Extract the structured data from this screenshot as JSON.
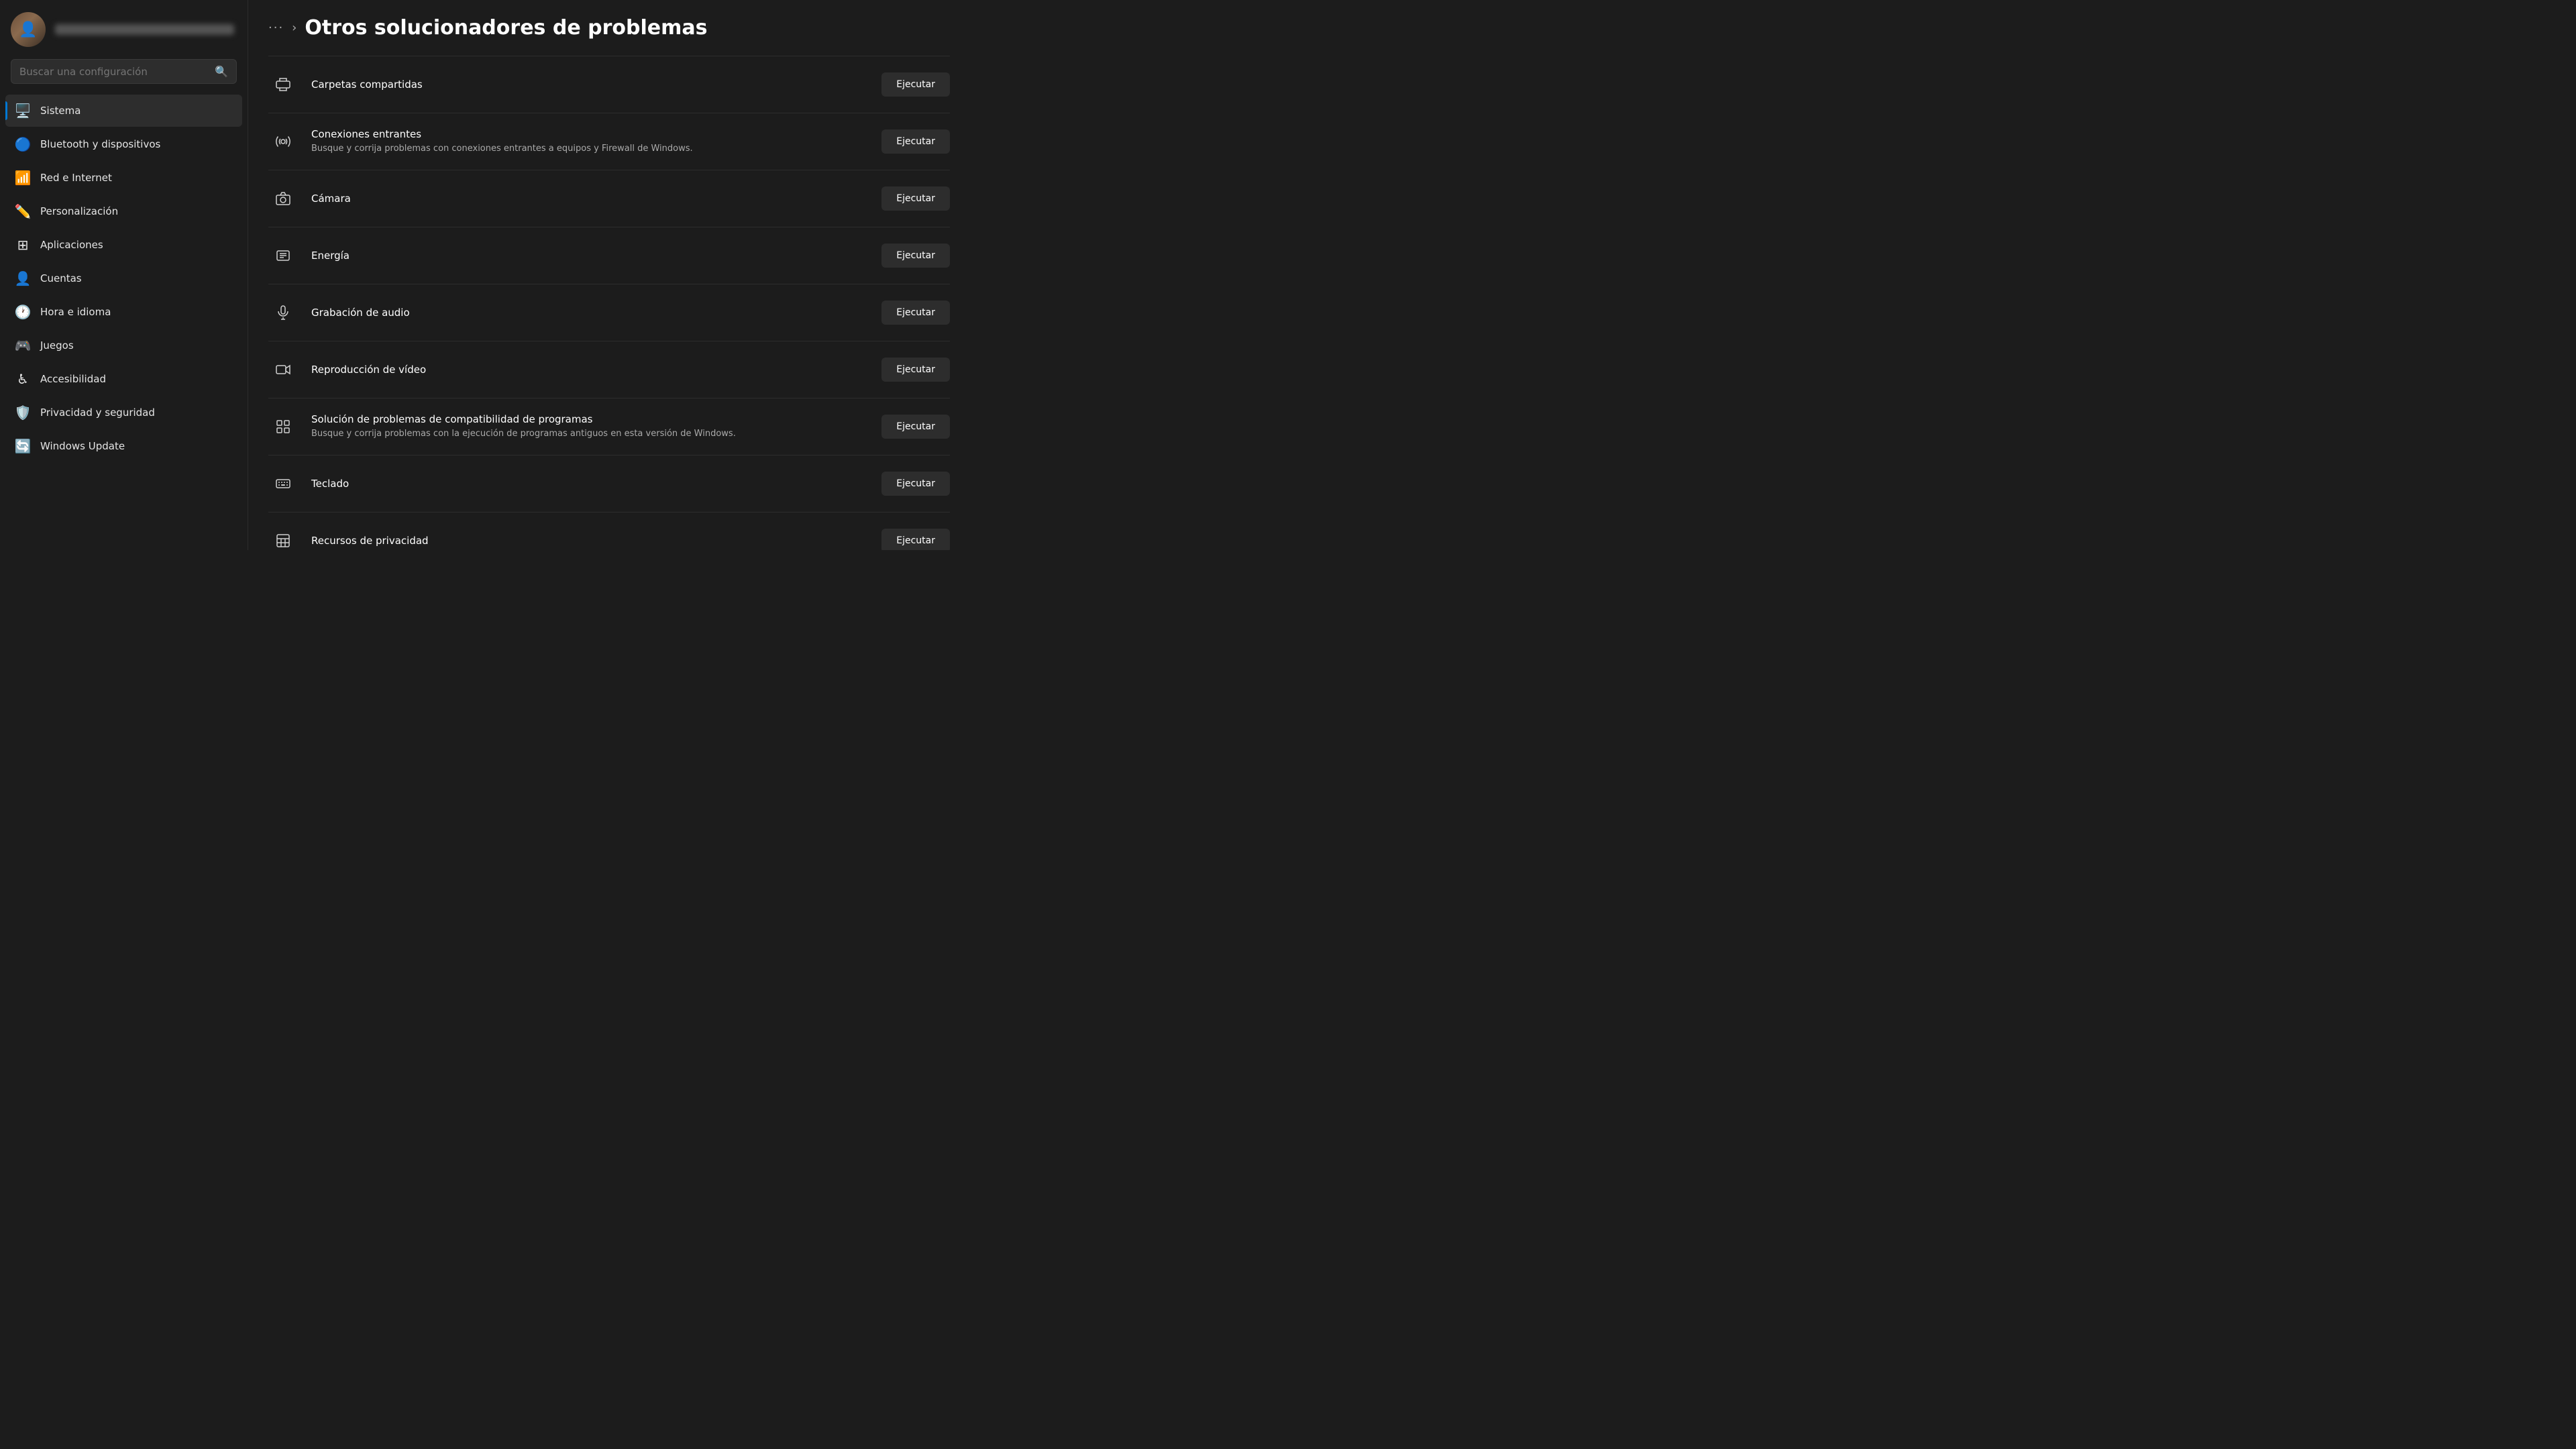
{
  "sidebar": {
    "search_placeholder": "Buscar una configuración",
    "items": [
      {
        "id": "sistema",
        "label": "Sistema",
        "icon": "🖥️",
        "active": true,
        "color": "#0078d4"
      },
      {
        "id": "bluetooth",
        "label": "Bluetooth y dispositivos",
        "icon": "bluetooth",
        "active": false
      },
      {
        "id": "red",
        "label": "Red e Internet",
        "icon": "wifi",
        "active": false
      },
      {
        "id": "personalizacion",
        "label": "Personalización",
        "icon": "pencil",
        "active": false
      },
      {
        "id": "aplicaciones",
        "label": "Aplicaciones",
        "icon": "grid",
        "active": false
      },
      {
        "id": "cuentas",
        "label": "Cuentas",
        "icon": "person",
        "active": false
      },
      {
        "id": "hora",
        "label": "Hora e idioma",
        "icon": "clock",
        "active": false
      },
      {
        "id": "juegos",
        "label": "Juegos",
        "icon": "gamepad",
        "active": false
      },
      {
        "id": "accesibilidad",
        "label": "Accesibilidad",
        "icon": "accessibility",
        "active": false
      },
      {
        "id": "privacidad",
        "label": "Privacidad y seguridad",
        "icon": "shield",
        "active": false
      },
      {
        "id": "windows-update",
        "label": "Windows Update",
        "icon": "update",
        "active": false
      }
    ]
  },
  "header": {
    "breadcrumb_dots": "···",
    "breadcrumb_chevron": "›",
    "title": "Otros solucionadores de problemas"
  },
  "troubleshooters": [
    {
      "id": "carpetas",
      "icon": "printer",
      "title": "Carpetas compartidas",
      "description": "",
      "button_label": "Ejecutar"
    },
    {
      "id": "conexiones",
      "icon": "wifi-incoming",
      "title": "Conexiones entrantes",
      "description": "Busque y corrija problemas con conexiones entrantes a equipos y Firewall de Windows.",
      "button_label": "Ejecutar"
    },
    {
      "id": "camara",
      "icon": "camera",
      "title": "Cámara",
      "description": "",
      "button_label": "Ejecutar"
    },
    {
      "id": "energia",
      "icon": "power",
      "title": "Energía",
      "description": "",
      "button_label": "Ejecutar"
    },
    {
      "id": "grabacion",
      "icon": "microphone",
      "title": "Grabación de audio",
      "description": "",
      "button_label": "Ejecutar"
    },
    {
      "id": "video",
      "icon": "video",
      "title": "Reproducción de vídeo",
      "description": "",
      "button_label": "Ejecutar"
    },
    {
      "id": "compatibilidad",
      "icon": "compat",
      "title": "Solución de problemas de compatibilidad de programas",
      "description": "Busque y corrija problemas con la ejecución de programas antiguos en esta versión de Windows.",
      "button_label": "Ejecutar"
    },
    {
      "id": "teclado",
      "icon": "keyboard",
      "title": "Teclado",
      "description": "",
      "button_label": "Ejecutar"
    },
    {
      "id": "privacidad-recursos",
      "icon": "privacy",
      "title": "Recursos de privacidad",
      "description": "",
      "button_label": "Ejecutar"
    }
  ]
}
